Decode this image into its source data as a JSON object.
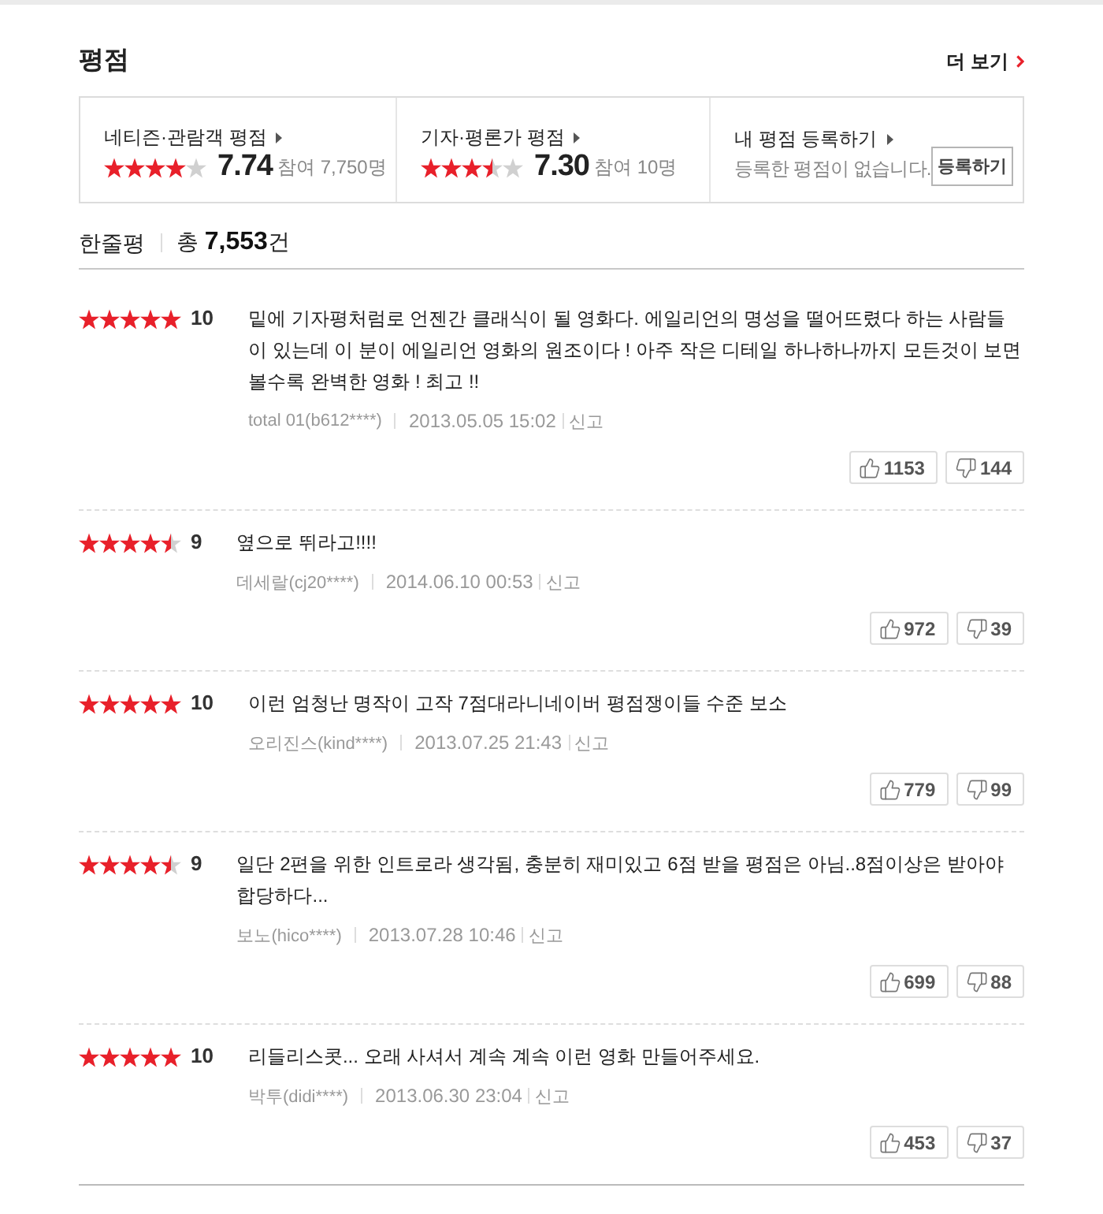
{
  "section": {
    "title": "평점",
    "more_link": "더 보기"
  },
  "summary": [
    {
      "kind": "score",
      "label": "네티즌·관람객 평점",
      "stars": 4,
      "score": "7.74",
      "participants": "참여 7,750명"
    },
    {
      "kind": "score",
      "label": "기자·평론가 평점",
      "stars": 3.5,
      "score": "7.30",
      "participants": "참여 10명"
    },
    {
      "kind": "register",
      "label": "내 평점 등록하기",
      "message": "등록한 평점이 없습니다.",
      "button": "등록하기"
    }
  ],
  "reviews_header": {
    "title": "한줄평",
    "total": "총 **7,553**건"
  },
  "reviews": [
    {
      "stars": 5,
      "score": "10",
      "text": "밑에 기자평처럼로 언젠간 클래식이 될 영화다. 에일리언의 명성을 떨어뜨렸다 하는 사람들이 있는데 이 분이 에일리언 영화의 원조이다 ! 아주 작은 디테일 하나하나까지 모든것이 보면 볼수록 완벽한 영화 ! 최고 !!",
      "author": "total 01(b612****)",
      "date": "2013.05.05 15:02",
      "report": "신고",
      "likes": "1153",
      "dislikes": "144"
    },
    {
      "stars": 4.5,
      "score": "9",
      "text": "옆으로 뛰라고!!!!",
      "author": "데세랄(cj20****)",
      "date": "2014.06.10 00:53",
      "report": "신고",
      "likes": "972",
      "dislikes": "39"
    },
    {
      "stars": 5,
      "score": "10",
      "text": "이런 엄청난 명작이 고작 7점대라니네이버 평점쟁이들 수준 보소",
      "author": "오리진스(kind****)",
      "date": "2013.07.25 21:43",
      "report": "신고",
      "likes": "779",
      "dislikes": "99"
    },
    {
      "stars": 4.5,
      "score": "9",
      "text": "일단 2편을 위한 인트로라 생각됨, 충분히 재미있고 6점 받을 평점은 아님..8점이상은 받아야 합당하다...",
      "author": "보노(hico****)",
      "date": "2013.07.28 10:46",
      "report": "신고",
      "likes": "699",
      "dislikes": "88"
    },
    {
      "stars": 5,
      "score": "10",
      "text": "리들리스콧... 오래 사셔서 계속 계속 이런 영화 만들어주세요.",
      "author": "박투(didi****)",
      "date": "2013.06.30 23:04",
      "report": "신고",
      "likes": "453",
      "dislikes": "37"
    }
  ]
}
